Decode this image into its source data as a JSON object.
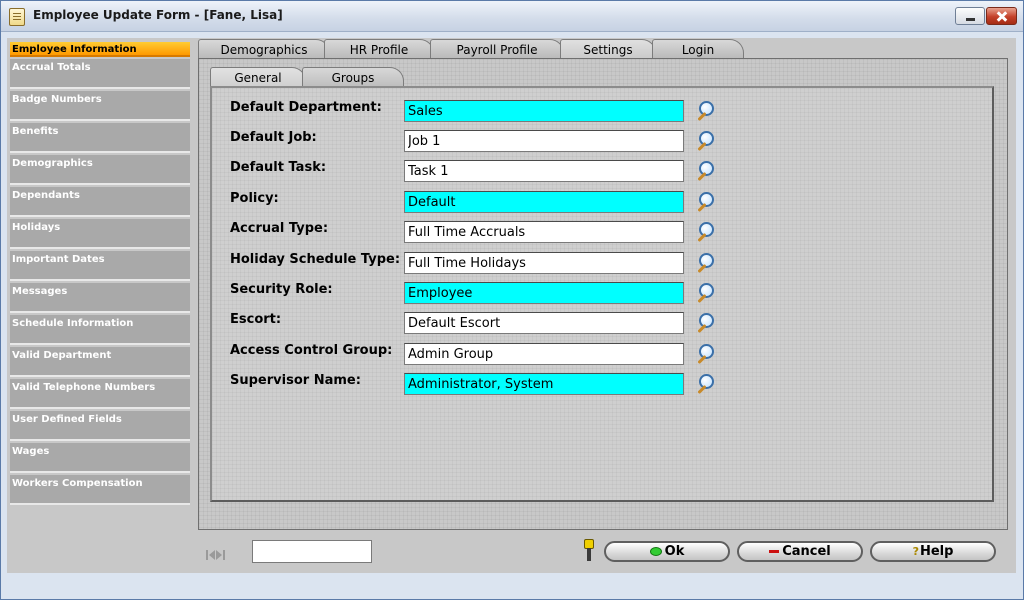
{
  "window": {
    "title": "Employee Update Form - [Fane, Lisa]",
    "icon": "form-icon"
  },
  "left_nav": {
    "header": "Employee Information",
    "items": [
      {
        "label": "Accrual Totals"
      },
      {
        "label": "Badge Numbers"
      },
      {
        "label": "Benefits"
      },
      {
        "label": "Demographics"
      },
      {
        "label": "Dependants"
      },
      {
        "label": "Holidays"
      },
      {
        "label": "Important Dates"
      },
      {
        "label": "Messages"
      },
      {
        "label": "Schedule Information"
      },
      {
        "label": "Valid Department"
      },
      {
        "label": "Valid Telephone Numbers"
      },
      {
        "label": "User Defined Fields"
      },
      {
        "label": "Wages"
      },
      {
        "label": "Workers Compensation"
      }
    ]
  },
  "tabs": [
    {
      "label": "Demographics"
    },
    {
      "label": "HR Profile"
    },
    {
      "label": "Payroll Profile"
    },
    {
      "label": "Settings"
    },
    {
      "label": "Login"
    }
  ],
  "active_tab": "Settings",
  "subtabs": [
    {
      "label": "General"
    },
    {
      "label": "Groups"
    }
  ],
  "active_subtab": "General",
  "fields": [
    {
      "label": "Default Department:",
      "value": "Sales",
      "highlight": "#00ffff"
    },
    {
      "label": "Default Job:",
      "value": "Job 1",
      "highlight": "#ffffff"
    },
    {
      "label": "Default Task:",
      "value": "Task 1",
      "highlight": "#ffffff"
    },
    {
      "label": "Policy:",
      "value": "Default",
      "highlight": "#00ffff"
    },
    {
      "label": "Accrual Type:",
      "value": "Full Time Accruals",
      "highlight": "#ffffff"
    },
    {
      "label": "Holiday Schedule Type:",
      "value": "Full Time Holidays",
      "highlight": "#ffffff"
    },
    {
      "label": "Security Role:",
      "value": "Employee",
      "highlight": "#00ffff"
    },
    {
      "label": "Escort:",
      "value": "Default Escort",
      "highlight": "#ffffff"
    },
    {
      "label": "Access Control Group:",
      "value": "Admin Group",
      "highlight": "#ffffff"
    },
    {
      "label": "Supervisor Name:",
      "value": "Administrator, System",
      "highlight": "#00ffff"
    }
  ],
  "footer": {
    "record_value": "",
    "ok_label": "Ok",
    "cancel_label": "Cancel",
    "help_label": "Help"
  },
  "colors": {
    "nav_header": "#ff9900",
    "nav_item": "#a9a9a9",
    "required_field": "#00ffff"
  }
}
